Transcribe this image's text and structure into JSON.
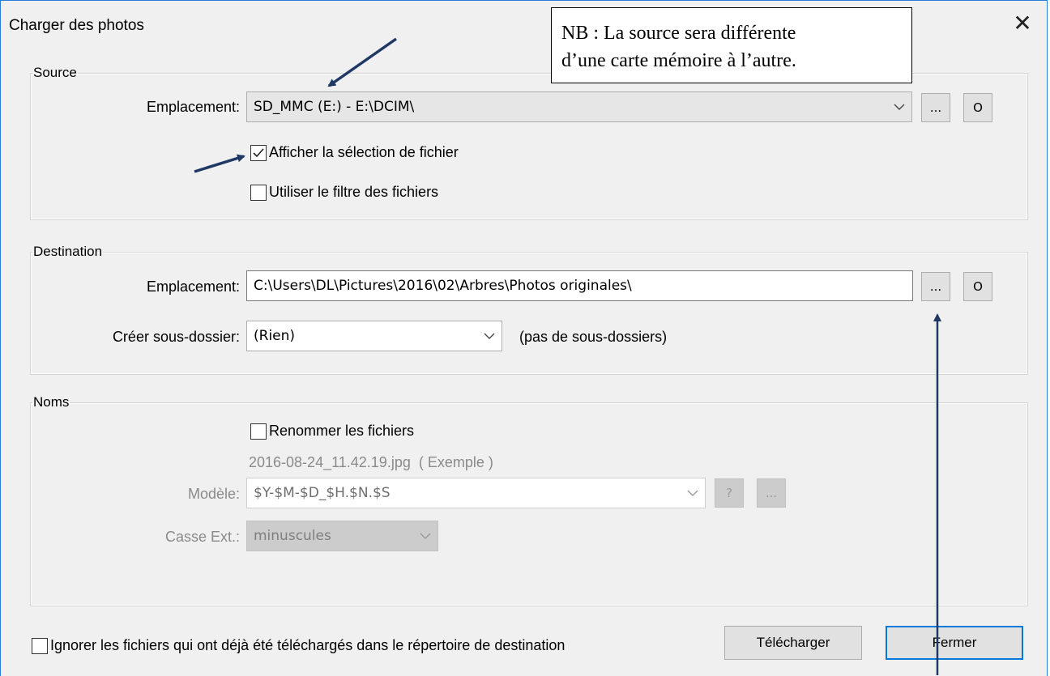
{
  "window": {
    "title": "Charger des photos",
    "close_label": "✕"
  },
  "note": {
    "line1": "NB : La source sera différente",
    "line2": "d’une carte mémoire à l’autre."
  },
  "source": {
    "legend": "Source",
    "location_label": "Emplacement:",
    "location_value": "SD_MMC (E:) - E:\\DCIM\\",
    "browse_label": "...",
    "open_label": "O",
    "show_selection_label": "Afficher la sélection de fichier",
    "show_selection_checked": true,
    "use_filter_label": "Utiliser le filtre des fichiers",
    "use_filter_checked": false
  },
  "destination": {
    "legend": "Destination",
    "location_label": "Emplacement:",
    "location_value": "C:\\Users\\DL\\Pictures\\2016\\02\\Arbres\\Photos originales\\",
    "browse_label": "...",
    "open_label": "O",
    "subfolder_label": "Créer sous-dossier:",
    "subfolder_value": "(Rien)",
    "subfolder_hint": "(pas de sous-dossiers)"
  },
  "names": {
    "legend": "Noms",
    "rename_label": "Renommer les fichiers",
    "rename_checked": false,
    "example_text": "2016-08-24_11.42.19.jpg  ( Exemple )",
    "model_label": "Modèle:",
    "model_value": "$Y-$M-$D_$H.$N.$S",
    "help_label": "?",
    "more_label": "...",
    "ext_case_label": "Casse Ext.:",
    "ext_case_value": "minuscules"
  },
  "footer": {
    "ignore_label": "Ignorer les fichiers qui ont déjà été téléchargés dans le répertoire de destination",
    "ignore_checked": false,
    "download_label": "Télécharger",
    "close_label": "Fermer"
  },
  "colors": {
    "accent": "#0078d7",
    "arrow": "#1f3864",
    "window_border": "#2b79d8"
  }
}
